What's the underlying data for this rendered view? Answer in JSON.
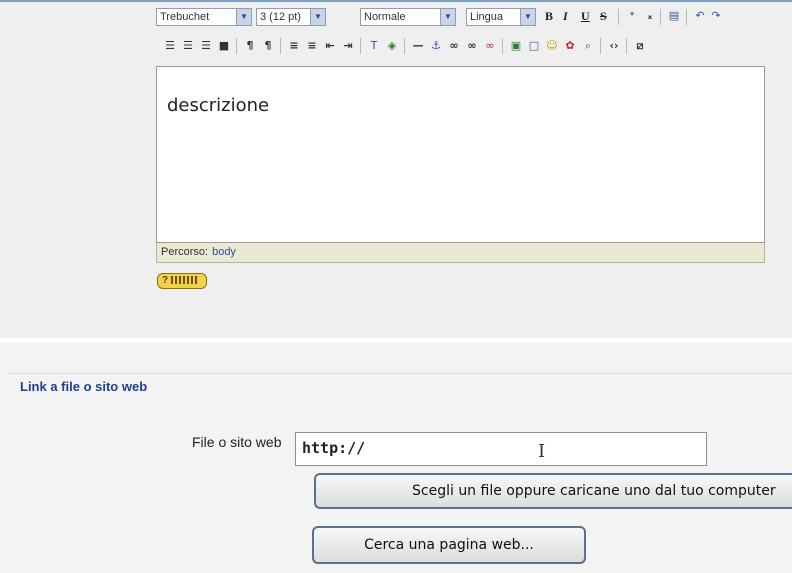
{
  "editor": {
    "font_select": "Trebuchet",
    "size_select": "3 (12 pt)",
    "style_select": "Normale",
    "lang_select": "Lingua",
    "content": "descrizione",
    "path_label": "Percorso:",
    "path_value": "body"
  },
  "icons": {
    "bold": "B",
    "italic": "I",
    "underline": "U",
    "strike": "S"
  },
  "section": {
    "title": "Link a file o sito web",
    "field_label": "File o sito web",
    "url_value": "http://",
    "choose_file_button": "Scegli un file oppure caricane uno dal tuo computer",
    "search_web_button": "Cerca una pagina web..."
  },
  "colors": {
    "accent": "#1f3f8f",
    "help_button": "#f3d24b",
    "path_bar": "#ebe8d4"
  }
}
